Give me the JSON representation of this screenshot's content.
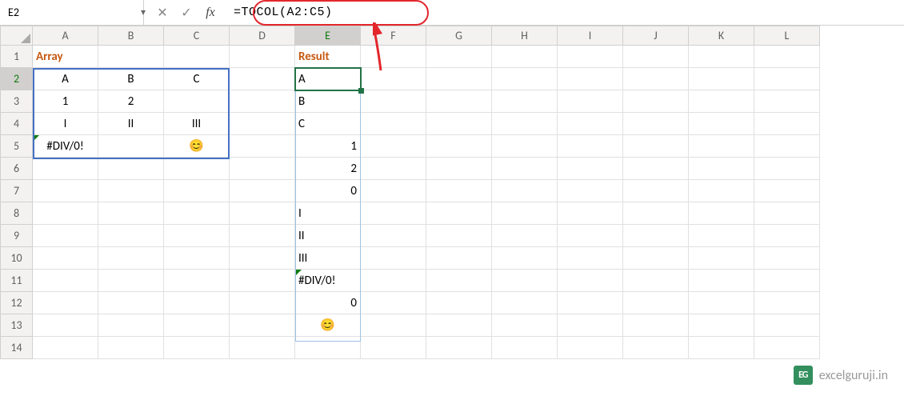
{
  "nameBox": "E2",
  "formula": "=TOCOL(A2:C5)",
  "columns": [
    "A",
    "B",
    "C",
    "D",
    "E",
    "F",
    "G",
    "H",
    "I",
    "J",
    "K",
    "L"
  ],
  "rows": [
    "1",
    "2",
    "3",
    "4",
    "5",
    "6",
    "7",
    "8",
    "9",
    "10",
    "11",
    "12",
    "13",
    "14"
  ],
  "headers": {
    "array": "Array",
    "result": "Result"
  },
  "arrayData": {
    "r2": {
      "A": "A",
      "B": "B",
      "C": "C"
    },
    "r3": {
      "A": "1",
      "B": "2",
      "C": ""
    },
    "r4": {
      "A": "I",
      "B": "II",
      "C": "III"
    },
    "r5": {
      "A": "#DIV/0!",
      "B": "",
      "C": "😊"
    }
  },
  "result": {
    "E2": "A",
    "E3": "B",
    "E4": "C",
    "E5": "1",
    "E6": "2",
    "E7": "0",
    "E8": "I",
    "E9": "II",
    "E10": "III",
    "E11": "#DIV/0!",
    "E12": "0",
    "E13": "😊"
  },
  "watermark": {
    "badge": "EG",
    "text": "excelguruji.in"
  },
  "chart_data": {
    "type": "table",
    "title": "Excel TOCOL function example",
    "input_range": "A2:C5",
    "input": [
      [
        "A",
        "B",
        "C"
      ],
      [
        1,
        2,
        null
      ],
      [
        "I",
        "II",
        "III"
      ],
      [
        "#DIV/0!",
        null,
        "😊"
      ]
    ],
    "output_range": "E2:E13",
    "output": [
      "A",
      "B",
      "C",
      1,
      2,
      0,
      "I",
      "II",
      "III",
      "#DIV/0!",
      0,
      "😊"
    ]
  }
}
